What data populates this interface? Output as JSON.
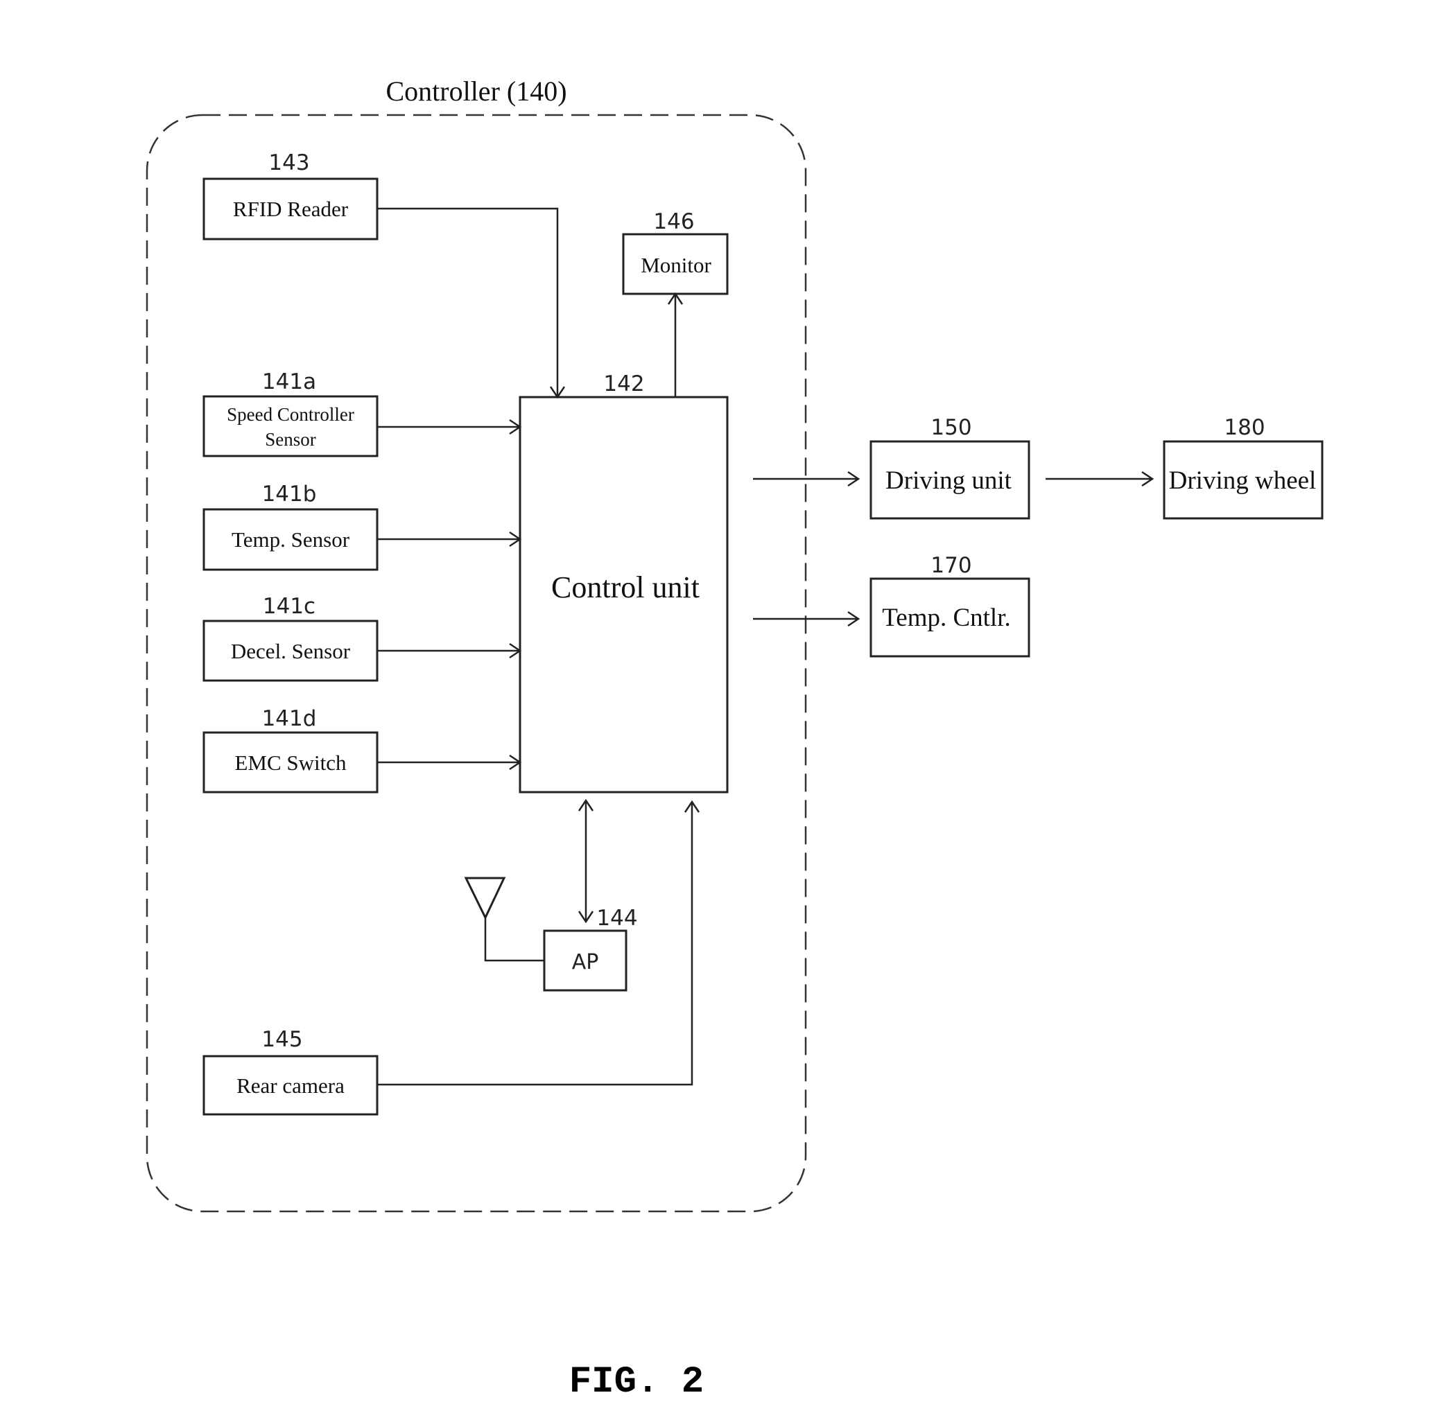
{
  "figure_label": "FIG. 2",
  "controller": {
    "title": "Controller (140)"
  },
  "blocks": {
    "rfid": {
      "ref": "143",
      "label": "RFID Reader"
    },
    "speed": {
      "ref": "141a",
      "label_line1": "Speed Controller",
      "label_line2": "Sensor"
    },
    "temp_sensor": {
      "ref": "141b",
      "label": "Temp. Sensor"
    },
    "decel": {
      "ref": "141c",
      "label": "Decel. Sensor"
    },
    "emc": {
      "ref": "141d",
      "label": "EMC Switch"
    },
    "rear_camera": {
      "ref": "145",
      "label": "Rear camera"
    },
    "control_unit": {
      "ref": "142",
      "label": "Control unit"
    },
    "monitor": {
      "ref": "146",
      "label": "Monitor"
    },
    "ap": {
      "ref": "144",
      "label": "AP"
    },
    "driving_unit": {
      "ref": "150",
      "label": "Driving unit"
    },
    "temp_cntlr": {
      "ref": "170",
      "label": "Temp. Cntlr."
    },
    "driving_wheel": {
      "ref": "180",
      "label": "Driving wheel"
    }
  },
  "connections": [
    {
      "from": "RFID Reader",
      "to": "Control unit",
      "type": "arrow"
    },
    {
      "from": "Speed Controller Sensor",
      "to": "Control unit",
      "type": "arrow"
    },
    {
      "from": "Temp. Sensor",
      "to": "Control unit",
      "type": "arrow"
    },
    {
      "from": "Decel. Sensor",
      "to": "Control unit",
      "type": "arrow"
    },
    {
      "from": "EMC Switch",
      "to": "Control unit",
      "type": "arrow"
    },
    {
      "from": "Control unit",
      "to": "Monitor",
      "type": "arrow"
    },
    {
      "from": "Control unit",
      "to": "AP",
      "type": "bidirectional"
    },
    {
      "from": "Antenna",
      "to": "AP",
      "type": "line"
    },
    {
      "from": "Rear camera",
      "to": "Control unit",
      "type": "arrow"
    },
    {
      "from": "Control unit",
      "to": "Driving unit",
      "type": "arrow"
    },
    {
      "from": "Control unit",
      "to": "Temp. Cntlr.",
      "type": "arrow"
    },
    {
      "from": "Driving unit",
      "to": "Driving wheel",
      "type": "arrow"
    }
  ]
}
